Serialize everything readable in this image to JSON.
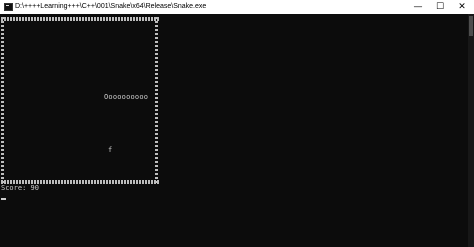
{
  "window": {
    "title": "D:\\++++Learning+++\\C++\\001\\Snake\\x64\\Release\\Snake.exe",
    "minimize_glyph": "—",
    "maximize_glyph": "☐",
    "close_glyph": "✕"
  },
  "game": {
    "snake": "Oooooooooo",
    "fruit": "f",
    "score_label": "Score:",
    "score": "90"
  },
  "colors": {
    "background": "#0c0c0c",
    "text": "#cccccc",
    "titlebar": "#ffffff"
  },
  "icons": [
    "console-app-icon",
    "minimize-icon",
    "maximize-icon",
    "close-icon"
  ]
}
